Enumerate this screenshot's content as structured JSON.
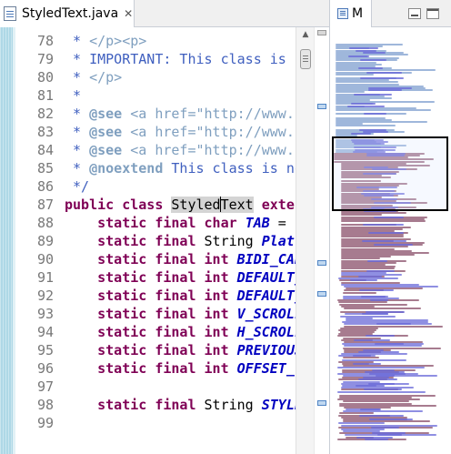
{
  "editor": {
    "tab": {
      "title": "StyledText.java",
      "close_glyph": "✕",
      "icon": "java-file-icon"
    },
    "colors": {
      "comment": "#3f5fbf",
      "keyword": "#7f0055",
      "constant": "#0000c0",
      "line_number": "#787878",
      "ruler": "#aed8e6"
    },
    "lines": [
      {
        "number": "78",
        "tokens": [
          {
            "t": " * ",
            "c": "comment"
          },
          {
            "t": "</p><p>",
            "c": "tag"
          }
        ]
      },
      {
        "number": "79",
        "tokens": [
          {
            "t": " * IMPORTANT: This class is ",
            "c": "comment"
          }
        ]
      },
      {
        "number": "80",
        "tokens": [
          {
            "t": " * ",
            "c": "comment"
          },
          {
            "t": "</p>",
            "c": "tag"
          }
        ]
      },
      {
        "number": "81",
        "tokens": [
          {
            "t": " *",
            "c": "comment"
          }
        ]
      },
      {
        "number": "82",
        "tokens": [
          {
            "t": " * ",
            "c": "comment"
          },
          {
            "t": "@see",
            "c": "javadoc"
          },
          {
            "t": " <a href=\"http://www.",
            "c": "tag"
          }
        ]
      },
      {
        "number": "83",
        "tokens": [
          {
            "t": " * ",
            "c": "comment"
          },
          {
            "t": "@see",
            "c": "javadoc"
          },
          {
            "t": " <a href=\"http://www.",
            "c": "tag"
          }
        ]
      },
      {
        "number": "84",
        "tokens": [
          {
            "t": " * ",
            "c": "comment"
          },
          {
            "t": "@see",
            "c": "javadoc"
          },
          {
            "t": " <a href=\"http://www.",
            "c": "tag"
          }
        ]
      },
      {
        "number": "85",
        "tokens": [
          {
            "t": " * ",
            "c": "comment"
          },
          {
            "t": "@noextend",
            "c": "javadoc"
          },
          {
            "t": " This class is no",
            "c": "comment"
          }
        ]
      },
      {
        "number": "86",
        "tokens": [
          {
            "t": " */",
            "c": "comment"
          }
        ]
      },
      {
        "number": "87",
        "tokens": [
          {
            "t": "public",
            "c": "kw"
          },
          {
            "t": " ",
            "c": "plain"
          },
          {
            "t": "class",
            "c": "kw"
          },
          {
            "t": " ",
            "c": "plain"
          },
          {
            "t": "Styled",
            "c": "hl"
          },
          {
            "t": "|",
            "c": "caret"
          },
          {
            "t": "Text",
            "c": "hl"
          },
          {
            "t": " ",
            "c": "plain"
          },
          {
            "t": "exter",
            "c": "kw"
          }
        ]
      },
      {
        "number": "88",
        "tokens": [
          {
            "t": "    ",
            "c": "plain"
          },
          {
            "t": "static",
            "c": "kw"
          },
          {
            "t": " ",
            "c": "plain"
          },
          {
            "t": "final",
            "c": "kw"
          },
          {
            "t": " ",
            "c": "plain"
          },
          {
            "t": "char",
            "c": "kw"
          },
          {
            "t": " ",
            "c": "plain"
          },
          {
            "t": "TAB",
            "c": "const"
          },
          {
            "t": " =",
            "c": "plain"
          }
        ]
      },
      {
        "number": "89",
        "tokens": [
          {
            "t": "    ",
            "c": "plain"
          },
          {
            "t": "static",
            "c": "kw"
          },
          {
            "t": " ",
            "c": "plain"
          },
          {
            "t": "final",
            "c": "kw"
          },
          {
            "t": " String ",
            "c": "plain"
          },
          {
            "t": "Platf",
            "c": "const"
          }
        ]
      },
      {
        "number": "90",
        "tokens": [
          {
            "t": "    ",
            "c": "plain"
          },
          {
            "t": "static",
            "c": "kw"
          },
          {
            "t": " ",
            "c": "plain"
          },
          {
            "t": "final",
            "c": "kw"
          },
          {
            "t": " ",
            "c": "plain"
          },
          {
            "t": "int",
            "c": "kw"
          },
          {
            "t": " ",
            "c": "plain"
          },
          {
            "t": "BIDI_CAR",
            "c": "const"
          }
        ]
      },
      {
        "number": "91",
        "tokens": [
          {
            "t": "    ",
            "c": "plain"
          },
          {
            "t": "static",
            "c": "kw"
          },
          {
            "t": " ",
            "c": "plain"
          },
          {
            "t": "final",
            "c": "kw"
          },
          {
            "t": " ",
            "c": "plain"
          },
          {
            "t": "int",
            "c": "kw"
          },
          {
            "t": " ",
            "c": "plain"
          },
          {
            "t": "DEFAULT_",
            "c": "const"
          }
        ]
      },
      {
        "number": "92",
        "tokens": [
          {
            "t": "    ",
            "c": "plain"
          },
          {
            "t": "static",
            "c": "kw"
          },
          {
            "t": " ",
            "c": "plain"
          },
          {
            "t": "final",
            "c": "kw"
          },
          {
            "t": " ",
            "c": "plain"
          },
          {
            "t": "int",
            "c": "kw"
          },
          {
            "t": " ",
            "c": "plain"
          },
          {
            "t": "DEFAULT_",
            "c": "const"
          }
        ]
      },
      {
        "number": "93",
        "tokens": [
          {
            "t": "    ",
            "c": "plain"
          },
          {
            "t": "static",
            "c": "kw"
          },
          {
            "t": " ",
            "c": "plain"
          },
          {
            "t": "final",
            "c": "kw"
          },
          {
            "t": " ",
            "c": "plain"
          },
          {
            "t": "int",
            "c": "kw"
          },
          {
            "t": " ",
            "c": "plain"
          },
          {
            "t": "V_SCROLL",
            "c": "const"
          }
        ]
      },
      {
        "number": "94",
        "tokens": [
          {
            "t": "    ",
            "c": "plain"
          },
          {
            "t": "static",
            "c": "kw"
          },
          {
            "t": " ",
            "c": "plain"
          },
          {
            "t": "final",
            "c": "kw"
          },
          {
            "t": " ",
            "c": "plain"
          },
          {
            "t": "int",
            "c": "kw"
          },
          {
            "t": " ",
            "c": "plain"
          },
          {
            "t": "H_SCROLL",
            "c": "const"
          }
        ]
      },
      {
        "number": "95",
        "tokens": [
          {
            "t": "    ",
            "c": "plain"
          },
          {
            "t": "static",
            "c": "kw"
          },
          {
            "t": " ",
            "c": "plain"
          },
          {
            "t": "final",
            "c": "kw"
          },
          {
            "t": " ",
            "c": "plain"
          },
          {
            "t": "int",
            "c": "kw"
          },
          {
            "t": " ",
            "c": "plain"
          },
          {
            "t": "PREVIOUS",
            "c": "const"
          }
        ]
      },
      {
        "number": "96",
        "tokens": [
          {
            "t": "    ",
            "c": "plain"
          },
          {
            "t": "static",
            "c": "kw"
          },
          {
            "t": " ",
            "c": "plain"
          },
          {
            "t": "final",
            "c": "kw"
          },
          {
            "t": " ",
            "c": "plain"
          },
          {
            "t": "int",
            "c": "kw"
          },
          {
            "t": " ",
            "c": "plain"
          },
          {
            "t": "OFFSET_",
            "c": "const"
          }
        ]
      },
      {
        "number": "97",
        "tokens": []
      },
      {
        "number": "98",
        "tokens": [
          {
            "t": "    ",
            "c": "plain"
          },
          {
            "t": "static",
            "c": "kw"
          },
          {
            "t": " ",
            "c": "plain"
          },
          {
            "t": "final",
            "c": "kw"
          },
          {
            "t": " String ",
            "c": "plain"
          },
          {
            "t": "STYLE",
            "c": "const"
          }
        ]
      },
      {
        "number": "99",
        "tokens": []
      }
    ],
    "scrollbar": {
      "up_glyph": "▲"
    }
  },
  "minimap": {
    "tab": {
      "title": "M",
      "icon": "minimap-view-icon"
    },
    "colors": {
      "comment": "#7f9fcf",
      "code": "#8a4f6a",
      "constant": "#6a6ad8",
      "viewport": "#000000"
    }
  }
}
